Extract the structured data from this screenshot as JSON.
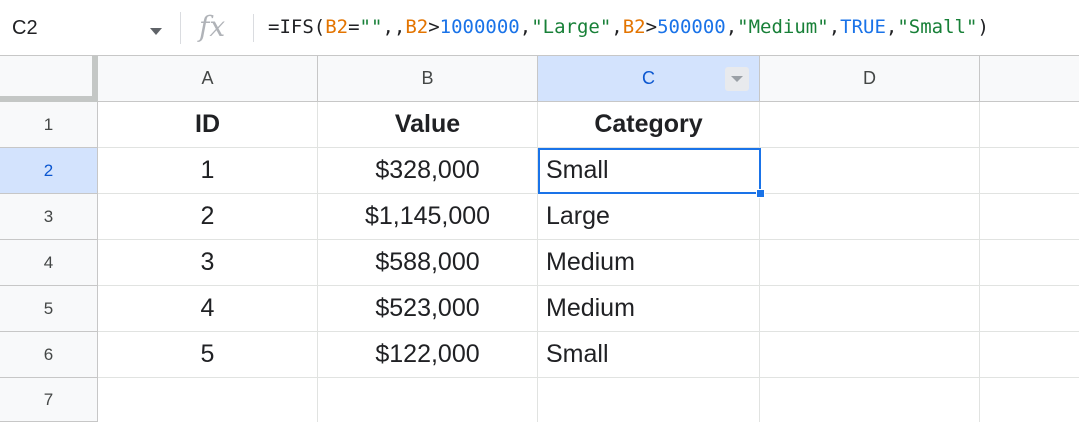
{
  "name_box": {
    "value": "C2"
  },
  "formula_bar": {
    "fx_icon": "fx",
    "tokens": [
      {
        "text": "=IFS(",
        "kind": "plain"
      },
      {
        "text": "B2",
        "kind": "ref"
      },
      {
        "text": "=",
        "kind": "plain"
      },
      {
        "text": "\"\"",
        "kind": "str"
      },
      {
        "text": ",,",
        "kind": "plain"
      },
      {
        "text": "B2",
        "kind": "ref"
      },
      {
        "text": ">",
        "kind": "plain"
      },
      {
        "text": "1000000",
        "kind": "num"
      },
      {
        "text": ",",
        "kind": "plain"
      },
      {
        "text": "\"Large\"",
        "kind": "str"
      },
      {
        "text": ",",
        "kind": "plain"
      },
      {
        "text": "B2",
        "kind": "ref"
      },
      {
        "text": ">",
        "kind": "plain"
      },
      {
        "text": "500000",
        "kind": "num"
      },
      {
        "text": ",",
        "kind": "plain"
      },
      {
        "text": "\"Medium\"",
        "kind": "str"
      },
      {
        "text": ",",
        "kind": "plain"
      },
      {
        "text": "TRUE",
        "kind": "bool"
      },
      {
        "text": ",",
        "kind": "plain"
      },
      {
        "text": "\"Small\"",
        "kind": "str"
      },
      {
        "text": ")",
        "kind": "plain"
      }
    ]
  },
  "columns": [
    "A",
    "B",
    "C",
    "D"
  ],
  "rows": [
    "1",
    "2",
    "3",
    "4",
    "5",
    "6",
    "7"
  ],
  "cells": [
    [
      "ID",
      "Value",
      "Category",
      ""
    ],
    [
      "1",
      "$328,000",
      "Small",
      ""
    ],
    [
      "2",
      "$1,145,000",
      "Large",
      ""
    ],
    [
      "3",
      "$588,000",
      "Medium",
      ""
    ],
    [
      "4",
      "$523,000",
      "Medium",
      ""
    ],
    [
      "5",
      "$122,000",
      "Small",
      ""
    ],
    [
      "",
      "",
      "",
      ""
    ]
  ],
  "selected_cell": "C2",
  "colors": {
    "selection": "#1a73e8",
    "header_selected_bg": "#d3e3fd",
    "reference": "#e37400",
    "string": "#188038",
    "number": "#1a73e8"
  }
}
